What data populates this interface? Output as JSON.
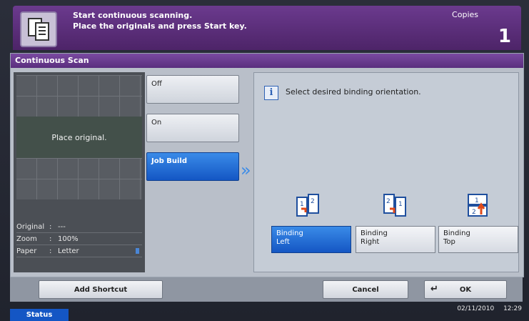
{
  "header": {
    "message_line1": "Start continuous scanning.",
    "message_line2": "Place the originals and press Start key.",
    "copies_label": "Copies",
    "copies_value": "1"
  },
  "panel": {
    "title": "Continuous Scan",
    "preview_text": "Place original.",
    "info": [
      {
        "key": "Original",
        "sep": ":",
        "value": "---"
      },
      {
        "key": "Zoom",
        "sep": ":",
        "value": "100%"
      },
      {
        "key": "Paper",
        "sep": ":",
        "value": "Letter"
      }
    ],
    "options": [
      {
        "label": "Off",
        "selected": false
      },
      {
        "label": "On",
        "selected": false
      },
      {
        "label": "Job Build",
        "selected": true
      }
    ],
    "instruction": "Select desired binding orientation.",
    "binding": [
      {
        "line1": "Binding",
        "line2": "Left",
        "selected": true,
        "icon": "binding-left-icon"
      },
      {
        "line1": "Binding",
        "line2": "Right",
        "selected": false,
        "icon": "binding-right-icon"
      },
      {
        "line1": "Binding",
        "line2": "Top",
        "selected": false,
        "icon": "binding-top-icon"
      }
    ]
  },
  "bottom": {
    "add_shortcut": "Add Shortcut",
    "cancel": "Cancel",
    "ok": "OK"
  },
  "status": {
    "label": "Status",
    "date": "02/11/2010",
    "time": "12:29"
  },
  "colors": {
    "header": "#5a2e7e",
    "selected": "#1456c4"
  }
}
